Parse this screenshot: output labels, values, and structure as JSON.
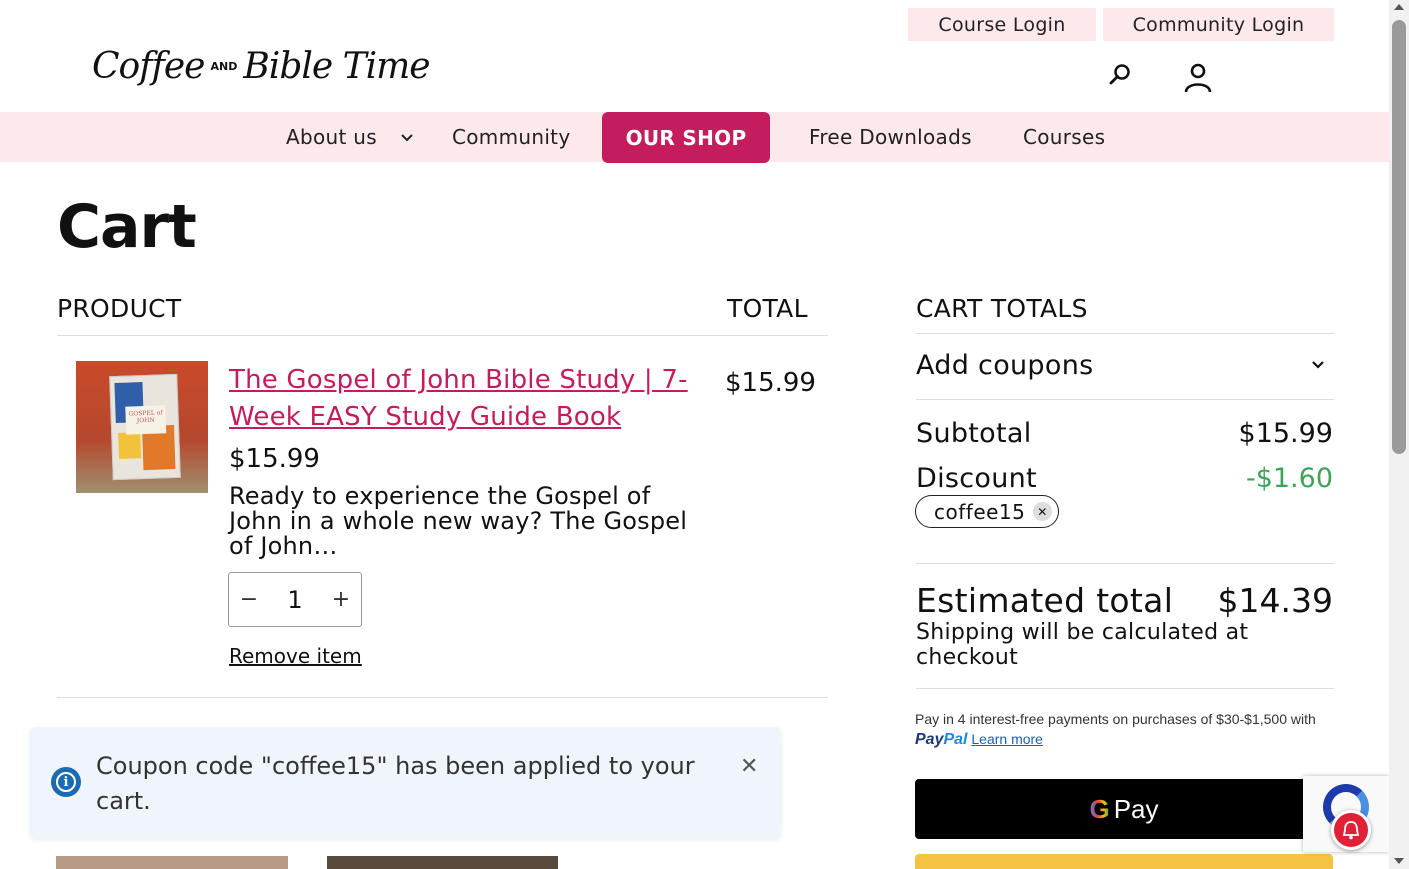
{
  "header": {
    "course_login": "Course Login",
    "community_login": "Community Login",
    "logo_coffee": "Coffee",
    "logo_and": "AND",
    "logo_bible_time": "Bible Time"
  },
  "nav": {
    "about": "About us",
    "community": "Community",
    "shop": "OUR SHOP",
    "free_downloads": "Free Downloads",
    "courses": "Courses"
  },
  "cart": {
    "title": "Cart",
    "col_product": "PRODUCT",
    "col_total": "TOTAL",
    "item": {
      "name": "The Gospel of John Bible Study | 7-Week EASY Study Guide Book",
      "price": "$15.99",
      "description": "Ready to experience the Gospel of John in a whole new way? The Gospel of John…",
      "quantity": "1",
      "line_total": "$15.99",
      "remove_label": "Remove item",
      "book_label": "GOSPEL of JOHN"
    }
  },
  "notice": {
    "text": "Coupon code \"coffee15\" has been applied to your cart."
  },
  "totals": {
    "heading": "CART TOTALS",
    "add_coupons": "Add coupons",
    "subtotal_label": "Subtotal",
    "subtotal_value": "$15.99",
    "discount_label": "Discount",
    "discount_value": "-$1.60",
    "coupon_code": "coffee15",
    "estimated_label": "Estimated total",
    "estimated_value": "$14.39",
    "shipping_note": "Shipping will be calculated at checkout",
    "paypal_message": "Pay in 4 interest-free payments on purchases of $30-$1,500 with",
    "paypal_pay": "Pay",
    "paypal_pal": "Pal",
    "learn_more": "Learn more",
    "gpay_label": "Pay"
  },
  "colors": {
    "accent": "#c41c5c",
    "nav_bg": "#fde8ec",
    "discount": "#3fa25a"
  }
}
